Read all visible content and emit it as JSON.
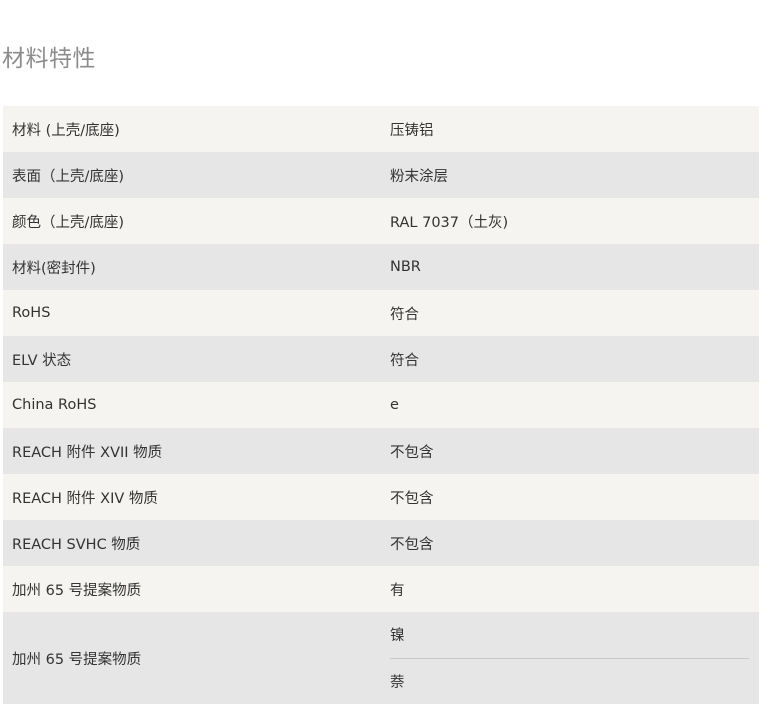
{
  "section": {
    "title": "材料特性"
  },
  "properties": [
    {
      "label": "材料 (上壳/底座)",
      "value": "压铸铝"
    },
    {
      "label": "表面（上壳/底座)",
      "value": "粉末涂层"
    },
    {
      "label": "颜色（上壳/底座)",
      "value": "RAL 7037（土灰)"
    },
    {
      "label": "材料(密封件)",
      "value": "NBR"
    },
    {
      "label": "RoHS",
      "value": "符合"
    },
    {
      "label": "ELV 状态",
      "value": "符合"
    },
    {
      "label": "China RoHS",
      "value": "e"
    },
    {
      "label": "REACH 附件 XVII 物质",
      "value": "不包含"
    },
    {
      "label": "REACH 附件 XIV 物质",
      "value": "不包含"
    },
    {
      "label": "REACH SVHC 物质",
      "value": "不包含"
    },
    {
      "label": "加州 65 号提案物质",
      "value": "有"
    },
    {
      "label": "加州 65 号提案物质",
      "values": [
        "镍",
        "萘"
      ]
    }
  ]
}
